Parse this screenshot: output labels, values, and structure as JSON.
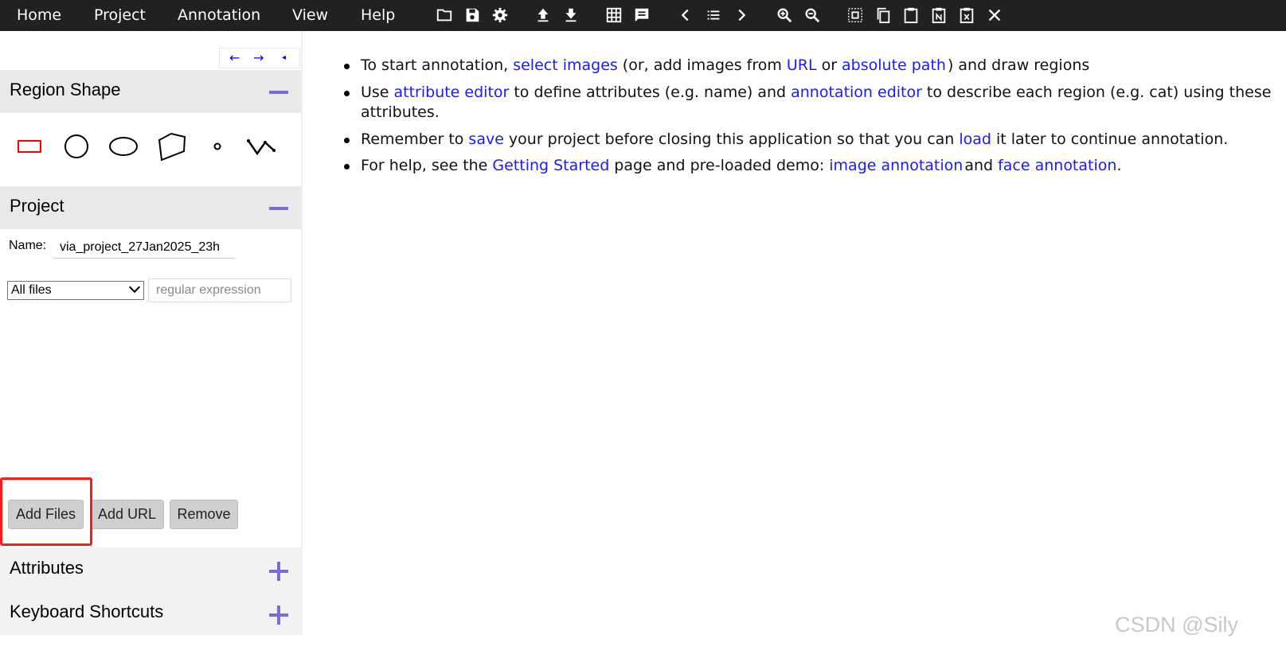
{
  "menubar": {
    "items": [
      "Home",
      "Project",
      "Annotation",
      "View",
      "Help"
    ],
    "icons": [
      "folder-open-icon",
      "save-icon",
      "settings-icon",
      "upload-icon",
      "download-icon",
      "grid-icon",
      "comment-icon",
      "chevron-left-icon",
      "list-icon",
      "chevron-right-icon",
      "zoom-in-icon",
      "zoom-out-icon",
      "select-all-icon",
      "copy-icon",
      "paste-icon",
      "paste-n-icon",
      "delete-icon",
      "close-icon"
    ]
  },
  "sidebar": {
    "nav": {
      "prev": "←",
      "next": "→",
      "collapse": "◂"
    },
    "region_shape": {
      "title": "Region Shape"
    },
    "shapes": [
      "rectangle",
      "circle",
      "ellipse",
      "polygon",
      "point",
      "polyline"
    ],
    "project": {
      "title": "Project",
      "name_label": "Name:",
      "name_value": "via_project_27Jan2025_23h",
      "filter_selected": "All files",
      "regex_placeholder": "regular expression"
    },
    "buttons": {
      "add_files": "Add Files",
      "add_url": "Add URL",
      "remove": "Remove"
    },
    "attributes": {
      "title": "Attributes"
    },
    "shortcuts": {
      "title": "Keyboard Shortcuts"
    }
  },
  "main": {
    "l1_a": "To start annotation,",
    "l1_link1": "select images",
    "l1_b": "(or, add images from",
    "l1_link2": "URL",
    "l1_c": "or",
    "l1_link3": "absolute path",
    "l1_d": ") and draw regions",
    "l2_a": "Use",
    "l2_link1": "attribute editor",
    "l2_b": "to define attributes (e.g. name) and",
    "l2_link2": "annotation editor",
    "l2_c": "to describe each region (e.g. cat) using these attributes.",
    "l3_a": "Remember to",
    "l3_link1": "save",
    "l3_b": "your project before closing this application so that you can",
    "l3_link2": "load",
    "l3_c": "it later to continue annotation.",
    "l4_a": "For help, see the",
    "l4_link1": "Getting Started",
    "l4_b": "page and pre-loaded demo:",
    "l4_link2": "image annotation",
    "l4_c": "and",
    "l4_link3": "face annotation",
    "l4_d": "."
  },
  "watermark": "CSDN @Sily",
  "colors": {
    "accent": "#7a6bd6",
    "link": "#1a1aff",
    "highlight": "#ff1a1a",
    "topbar": "#212121"
  }
}
